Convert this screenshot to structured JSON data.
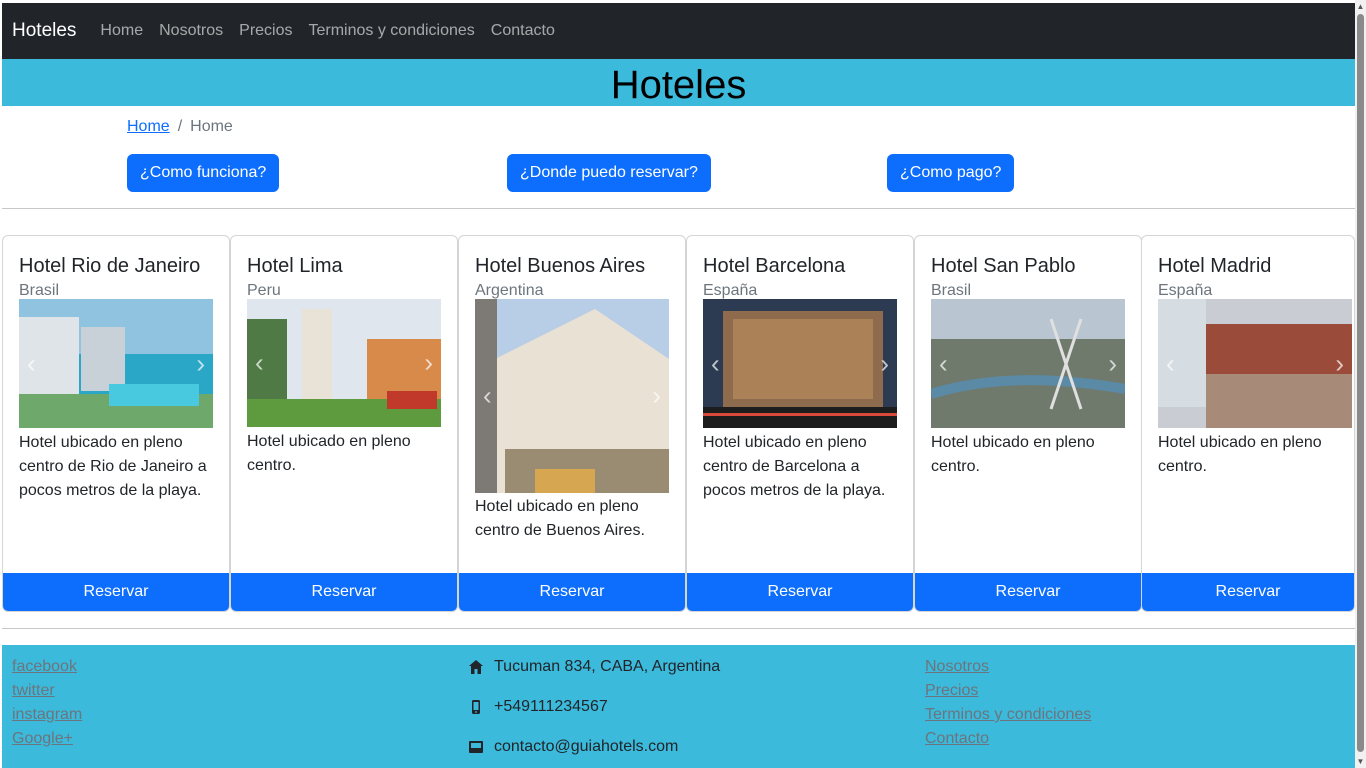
{
  "navbar": {
    "brand": "Hoteles",
    "links": [
      "Home",
      "Nosotros",
      "Precios",
      "Terminos y condiciones",
      "Contacto"
    ]
  },
  "hero": {
    "title": "Hoteles"
  },
  "breadcrumb": {
    "home_link": "Home",
    "separator": "/",
    "current": "Home"
  },
  "faq_buttons": [
    "¿Como funciona?",
    "¿Donde puedo reservar?",
    "¿Como pago?"
  ],
  "cards": [
    {
      "title": "Hotel Rio de Janeiro",
      "country": "Brasil",
      "text": "Hotel ubicado en pleno centro de Rio de Janeiro a pocos metros de la playa.",
      "button": "Reservar"
    },
    {
      "title": "Hotel Lima",
      "country": "Peru",
      "text": "Hotel ubicado en pleno centro.",
      "button": "Reservar"
    },
    {
      "title": "Hotel Buenos Aires",
      "country": "Argentina",
      "text": "Hotel ubicado en pleno centro de Buenos Aires.",
      "button": "Reservar"
    },
    {
      "title": "Hotel Barcelona",
      "country": "España",
      "text": "Hotel ubicado en pleno centro de Barcelona a pocos metros de la playa.",
      "button": "Reservar"
    },
    {
      "title": "Hotel San Pablo",
      "country": "Brasil",
      "text": "Hotel ubicado en pleno centro.",
      "button": "Reservar"
    },
    {
      "title": "Hotel Madrid",
      "country": "España",
      "text": "Hotel ubicado en pleno centro.",
      "button": "Reservar"
    }
  ],
  "footer": {
    "social": [
      "facebook",
      "twitter",
      "instagram",
      "Google+"
    ],
    "address": "Tucuman 834, CABA, Argentina",
    "phone": "+549111234567",
    "email": "contacto@guiahotels.com",
    "links": [
      "Nosotros",
      "Precios",
      "Terminos y condiciones",
      "Contacto"
    ]
  },
  "colors": {
    "navbar": "#212529",
    "accent": "#3bbadc",
    "primary": "#0d6efd"
  }
}
